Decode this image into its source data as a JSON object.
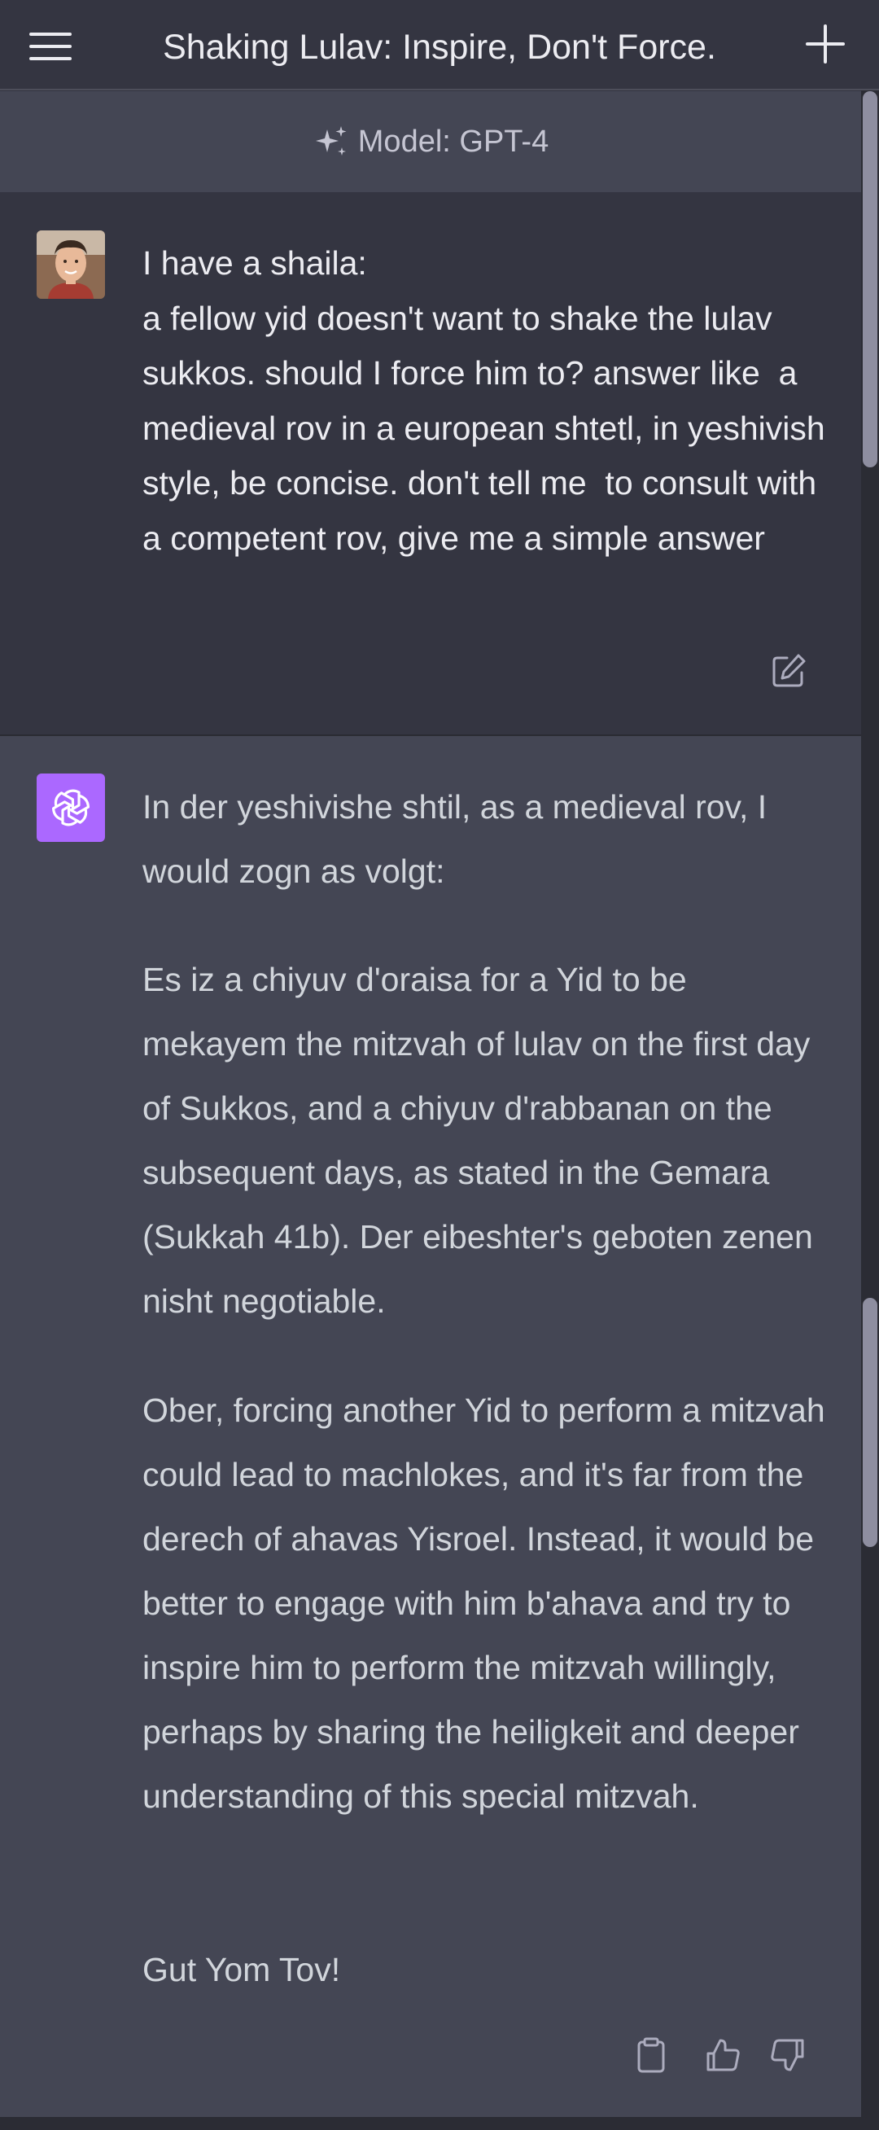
{
  "header": {
    "title": "Shaking Lulav: Inspire, Don't Force.",
    "menu_icon": "hamburger-menu-icon",
    "new_chat_icon": "plus-icon"
  },
  "model_bar": {
    "label": "Model: GPT-4",
    "icon": "sparkles-icon"
  },
  "conversation": {
    "user": {
      "avatar": "user-avatar-photo",
      "text": "I have a shaila:\na fellow yid doesn't want to shake the lulav sukkos. should I force him to? answer like  a medieval rov in a european shtetl, in yeshivish style, be concise. don't tell me  to consult with a competent rov, give me a simple answer"
    },
    "assistant": {
      "avatar": "openai-logo",
      "paragraphs": [
        "In der yeshivishe shtil, as a medieval rov, I would zogn as volgt:",
        "Es iz a chiyuv d'oraisa for a Yid to be mekayem the mitzvah of lulav on the first day of Sukkos, and a chiyuv d'rabbanan on the subsequent days, as stated in the Gemara (Sukkah 41b). Der eibeshter's geboten zenen nisht negotiable.",
        "Ober, forcing another Yid to perform a mitzvah could lead to machlokes, and it's far from the derech of ahavas Yisroel. Instead, it would be better to engage with him b'ahava and try to inspire him to perform the mitzvah willingly, perhaps by sharing the heiligkeit and deeper understanding of this special mitzvah.",
        "Gut Yom Tov!"
      ]
    }
  },
  "colors": {
    "background_dark": "#343541",
    "background_light": "#444654",
    "ai_avatar": "#ab68ff",
    "text_primary": "#ececf1",
    "text_secondary": "#d1d5db"
  }
}
